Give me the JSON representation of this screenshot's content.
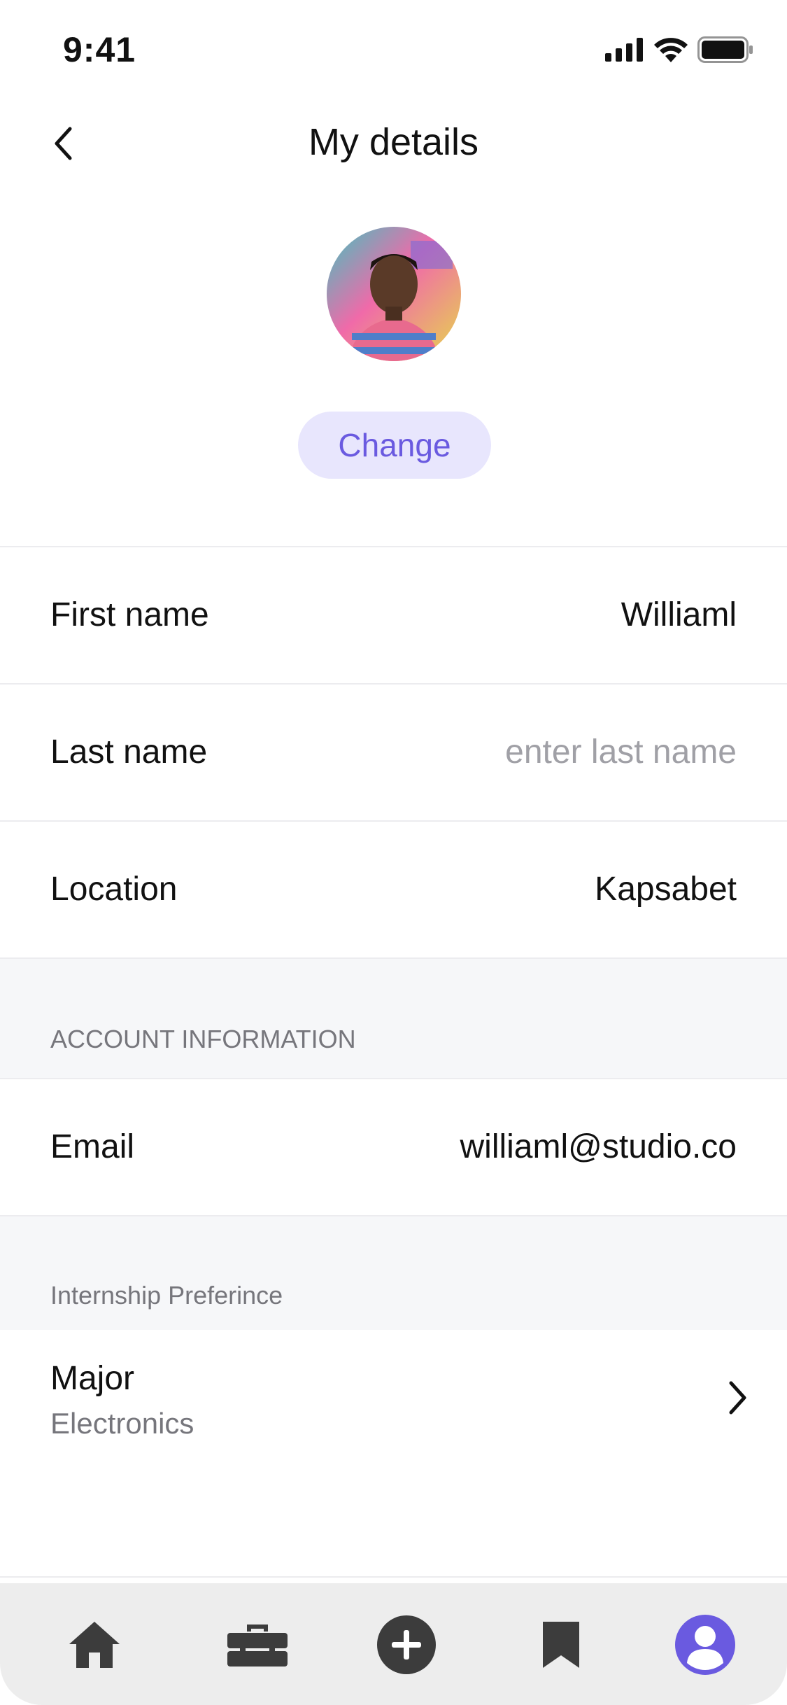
{
  "status_bar": {
    "time": "9:41",
    "icons": [
      "signal-icon",
      "wifi-icon",
      "battery-icon"
    ]
  },
  "header": {
    "back_icon": "chevron-left-icon",
    "title": "My details"
  },
  "profile": {
    "change_label": "Change"
  },
  "fields": [
    {
      "label": "First name",
      "value": "Williaml"
    },
    {
      "label": "Last name",
      "placeholder": "enter last name"
    },
    {
      "label": "Location",
      "value": "Kapsabet"
    }
  ],
  "account_section": {
    "title": "ACCOUNT INFORMATION",
    "email_label": "Email",
    "email_value": "williaml@studio.co"
  },
  "internship_section": {
    "title": "Internship Preferince",
    "major_label": "Major",
    "major_value": "Electronics"
  },
  "tab_bar": {
    "tabs": [
      "home-icon",
      "briefcase-icon",
      "add-icon",
      "bookmark-icon",
      "profile-icon"
    ],
    "active": "profile-icon"
  },
  "colors": {
    "accent": "#6a5ae0",
    "accent_soft": "#e8e6fd",
    "section_bg": "#f6f7f9",
    "tab_bar_bg": "#ededed",
    "icon_dark": "#3c3c3c"
  }
}
